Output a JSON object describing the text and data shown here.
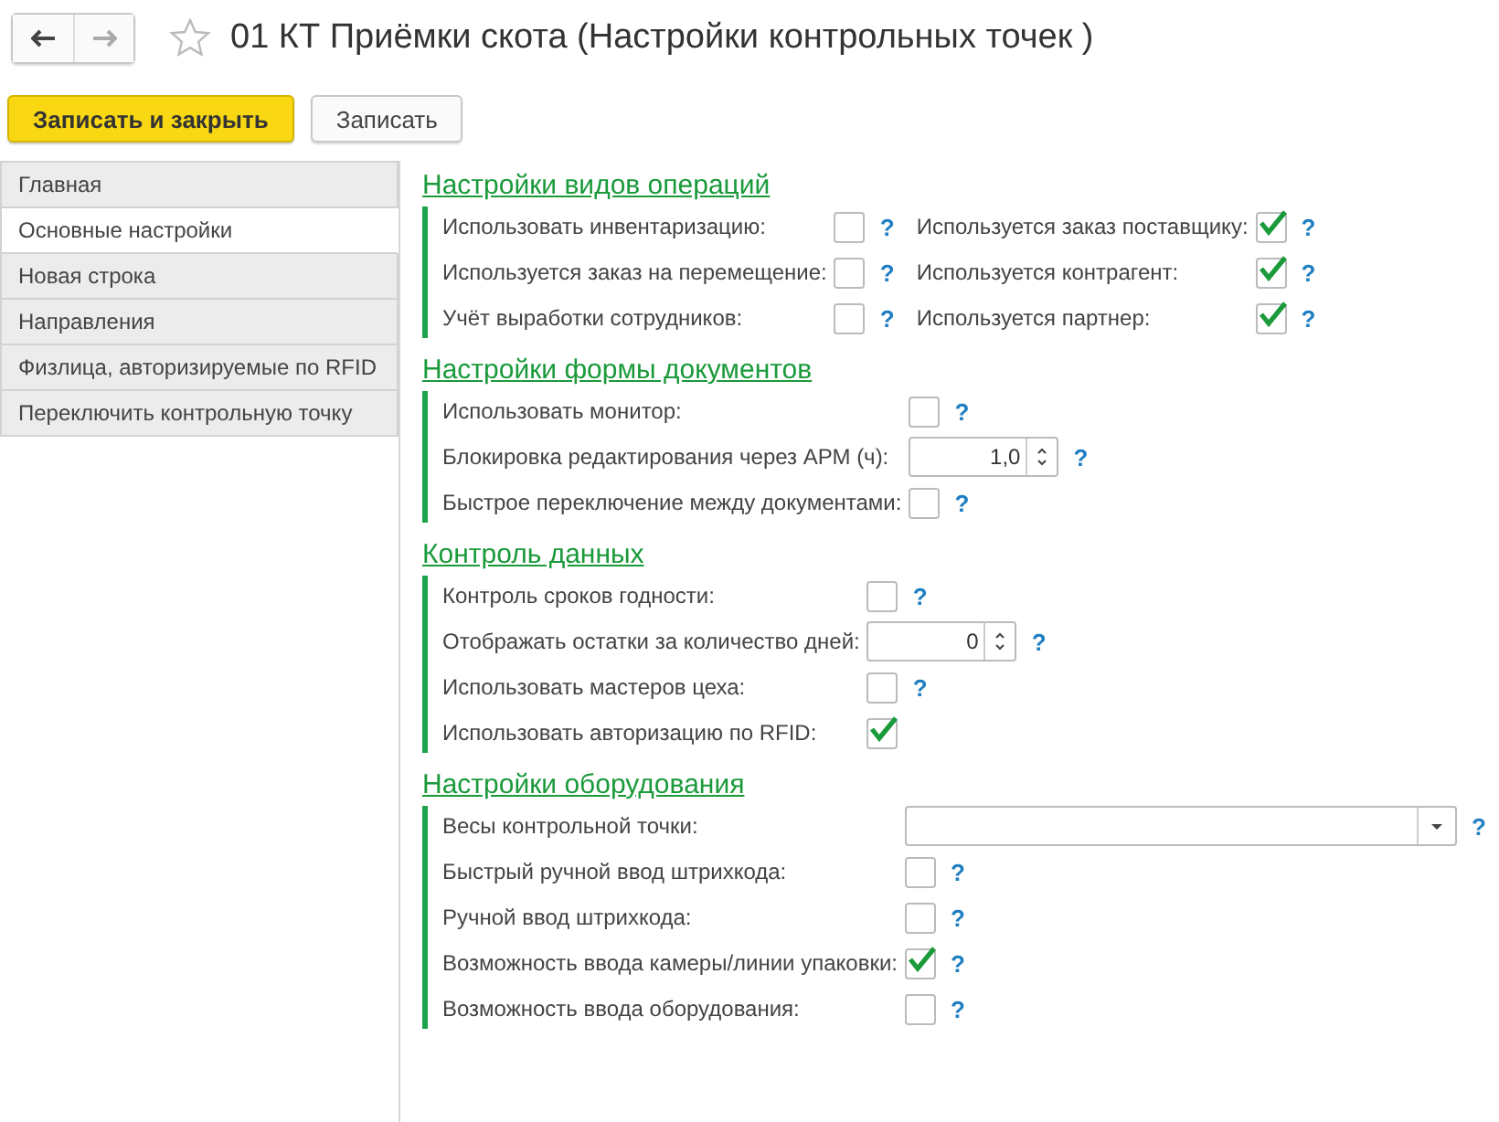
{
  "window": {
    "title": "01 КТ Приёмки скота (Настройки контрольных точек )",
    "favorite": false
  },
  "toolbar": {
    "buttons": [
      {
        "label": "Записать и закрыть",
        "kind": "primary"
      },
      {
        "label": "Записать",
        "kind": "normal"
      }
    ]
  },
  "sidebar": {
    "items": [
      {
        "label": "Главная",
        "selected": false
      },
      {
        "label": "Основные настройки",
        "selected": true
      },
      {
        "label": "Новая строка",
        "selected": false
      },
      {
        "label": "Направления",
        "selected": false
      },
      {
        "label": "Физлица, авторизируемые по RFID",
        "selected": false
      },
      {
        "label": "Переключить контрольную точку",
        "selected": false
      }
    ]
  },
  "sections": [
    {
      "title": "Настройки видов операций",
      "columns": [
        [
          {
            "kind": "checkbox",
            "label": "Использовать инвентаризацию:",
            "checked": false,
            "help": "?"
          },
          {
            "kind": "checkbox",
            "label": "Используется заказ на перемещение:",
            "checked": false,
            "help": "?"
          },
          {
            "kind": "checkbox",
            "label": "Учёт выработки сотрудников:",
            "checked": false,
            "help": "?"
          }
        ],
        [
          {
            "kind": "checkbox",
            "label": "Используется заказ поставщику:",
            "checked": true,
            "help": "?"
          },
          {
            "kind": "checkbox",
            "label": "Используется контрагент:",
            "checked": true,
            "help": "?"
          },
          {
            "kind": "checkbox",
            "label": "Используется партнер:",
            "checked": true,
            "help": "?"
          }
        ]
      ]
    },
    {
      "title": "Настройки формы документов",
      "columns": [
        [
          {
            "kind": "checkbox",
            "label": "Использовать монитор:",
            "checked": false,
            "help": "?"
          },
          {
            "kind": "number",
            "label": "Блокировка редактирования через АРМ (ч):",
            "value": "1,0",
            "help": "?"
          },
          {
            "kind": "checkbox",
            "label": "Быстрое переключение между документами:",
            "checked": false,
            "help": "?"
          }
        ]
      ]
    },
    {
      "title": "Контроль данных",
      "columns": [
        [
          {
            "kind": "checkbox",
            "label": "Контроль сроков годности:",
            "checked": false,
            "help": "?"
          },
          {
            "kind": "number",
            "label": "Отображать остатки за количество дней:",
            "value": "0",
            "help": "?"
          },
          {
            "kind": "checkbox",
            "label": "Использовать мастеров цеха:",
            "checked": false,
            "help": "?"
          },
          {
            "kind": "checkbox",
            "label": "Использовать авторизацию по RFID:",
            "checked": true
          }
        ]
      ]
    },
    {
      "title": "Настройки оборудования",
      "columns": [
        [
          {
            "kind": "select",
            "label": "Весы контрольной точки:",
            "help": "?"
          },
          {
            "kind": "checkbox",
            "label": "Быстрый ручной ввод штрихкода:",
            "checked": false,
            "help": "?"
          },
          {
            "kind": "checkbox",
            "label": "Ручной ввод штрихкода:",
            "checked": false,
            "help": "?"
          },
          {
            "kind": "checkbox",
            "label": "Возможность ввода камеры/линии упаковки:",
            "checked": true,
            "help": "?"
          },
          {
            "kind": "checkbox",
            "label": "Возможность ввода оборудования:",
            "checked": false,
            "help": "?"
          }
        ]
      ]
    }
  ]
}
